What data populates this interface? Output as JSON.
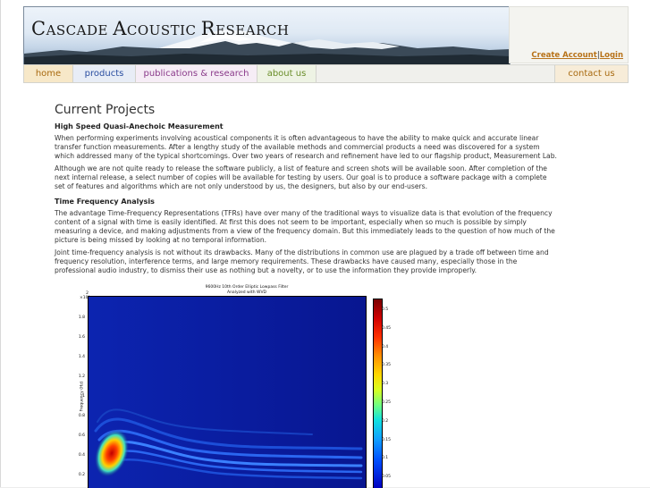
{
  "site": {
    "brand_big1": "C",
    "brand_small1": "ASCADE ",
    "brand_big2": "A",
    "brand_small2": "COUSTIC ",
    "brand_big3": "R",
    "brand_small3": "ESEARCH",
    "create_account": "Create Account",
    "separator": "|",
    "login": "Login"
  },
  "nav": {
    "home": "home",
    "products": "products",
    "pubs": "publications & research",
    "about": "about us",
    "contact": "contact us"
  },
  "content": {
    "title": "Current Projects",
    "section1_heading": "High Speed Quasi-Anechoic Measurement",
    "p1": "When performing experiments involving acoustical components it is often advantageous to have the ability to make quick and accurate linear transfer function measurements. After a lengthy study of the available methods and commercial products a need was discovered for a system which addressed many of the typical shortcomings. Over two years of research and refinement have led to our flagship product, Measurement Lab.",
    "p2": "Although we are not quite ready to release the software publicly, a list of feature and screen shots will be available soon. After completion of the next internal release, a select number of copies will be available for testing by users. Our goal is to produce a software package with a complete set of features and algorithms which are not only understood by us, the designers, but also by our end-users.",
    "section2_heading": "Time Frequency Analysis",
    "p3": "The advantage Time-Frequency Representations (TFRs) have over many of the traditional ways to visualize data is that evolution of the frequency content of a signal with time is easily identified. At first this does not seem to be important, especially when so much is possible by simply measuring a device, and making adjustments from a view of the frequency domain. But this immediately leads to the question of how much of the picture is being missed by looking at no temporal information.",
    "p4": "Joint time-frequency analysis is not without its drawbacks. Many of the distributions in common use are plagued by a trade off between time and frequency resolution, interference terms, and large memory requirements. These drawbacks have caused many, especially those in the professional audio industry, to dismiss their use as nothing but a novelty, or to use the information they provide improperly."
  },
  "figure": {
    "title_line1": "9600Hz 10th Order Elliptic Lowpass Filter",
    "title_line2": "Analyzed with WVD",
    "y_exp": "2 ×10⁴",
    "yticks": [
      "1.8",
      "1.6",
      "1.4",
      "1.2",
      "1",
      "0.8",
      "0.6",
      "0.4",
      "0.2"
    ],
    "ylabel": "Frequency (Hz)",
    "cbar_ticks": [
      "0.5",
      "0.45",
      "0.4",
      "0.35",
      "0.3",
      "0.25",
      "0.2",
      "0.15",
      "0.1",
      "0.05"
    ]
  }
}
